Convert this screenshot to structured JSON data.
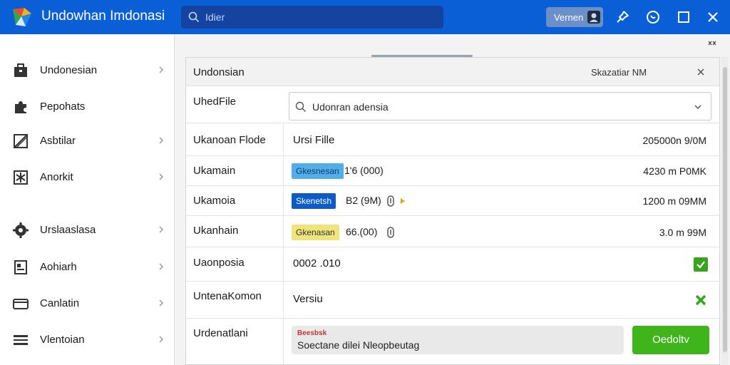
{
  "titlebar": {
    "app_title": "Undowhan Imdonasi",
    "search_placeholder": "Idier",
    "version_label": "Vernen"
  },
  "sidebar": {
    "items": [
      {
        "label": "Undonesian",
        "icon": "briefcase-icon",
        "chevron": true
      },
      {
        "label": "Pepohats",
        "icon": "puzzle-icon",
        "chevron": false
      },
      {
        "label": "Asbtilar",
        "icon": "slash-icon",
        "chevron": true
      },
      {
        "label": "Anorkit",
        "icon": "asterisk-icon",
        "chevron": true
      },
      {
        "label": "Urslaaslasa",
        "icon": "gear-icon",
        "chevron": true
      },
      {
        "label": "Aohiarh",
        "icon": "document-icon",
        "chevron": true
      },
      {
        "label": "Canlatin",
        "icon": "card-icon",
        "chevron": true
      },
      {
        "label": "Vlentoian",
        "icon": "menu-icon",
        "chevron": true
      }
    ]
  },
  "panel": {
    "title": "Undonsian",
    "meta": "Skazatiar NM",
    "file_row": {
      "key": "UhedFile",
      "combo_text": "Udonran adensia"
    },
    "header_row": {
      "key": "Ukanoan Flode",
      "val": "Ursi Fille",
      "right": "205000n 9/0M"
    },
    "rows": [
      {
        "key": "Ukamain",
        "badge": "Gkesnesan",
        "num": "1'6 (000)",
        "right": "4230 m P0MK"
      },
      {
        "key": "Ukamoia",
        "badge": "Skenetsh",
        "num": "B2 (9M)",
        "right": "1200 m 09MM"
      },
      {
        "key": "Ukanhain",
        "badge": "Gkenasan",
        "num": "66.(00)",
        "right": "3.0 m 99M"
      }
    ],
    "status_row": {
      "key": "Uaonposia",
      "val": "0002 .010"
    },
    "version_row": {
      "key": "UntenaKomon",
      "val": "Versiu"
    },
    "notice_row": {
      "key": "Urdenatlani",
      "notice_title": "Beesbsk",
      "notice_text": "Soectane dilei Nleopbeutag",
      "button": "Oedoltv"
    }
  },
  "colors": {
    "titlebar": "#0b5fd6",
    "accent_green": "#3fb51c",
    "badge_blue": "#52aee8",
    "badge_navy": "#0d5bc6",
    "badge_yellow": "#f0e57a"
  }
}
